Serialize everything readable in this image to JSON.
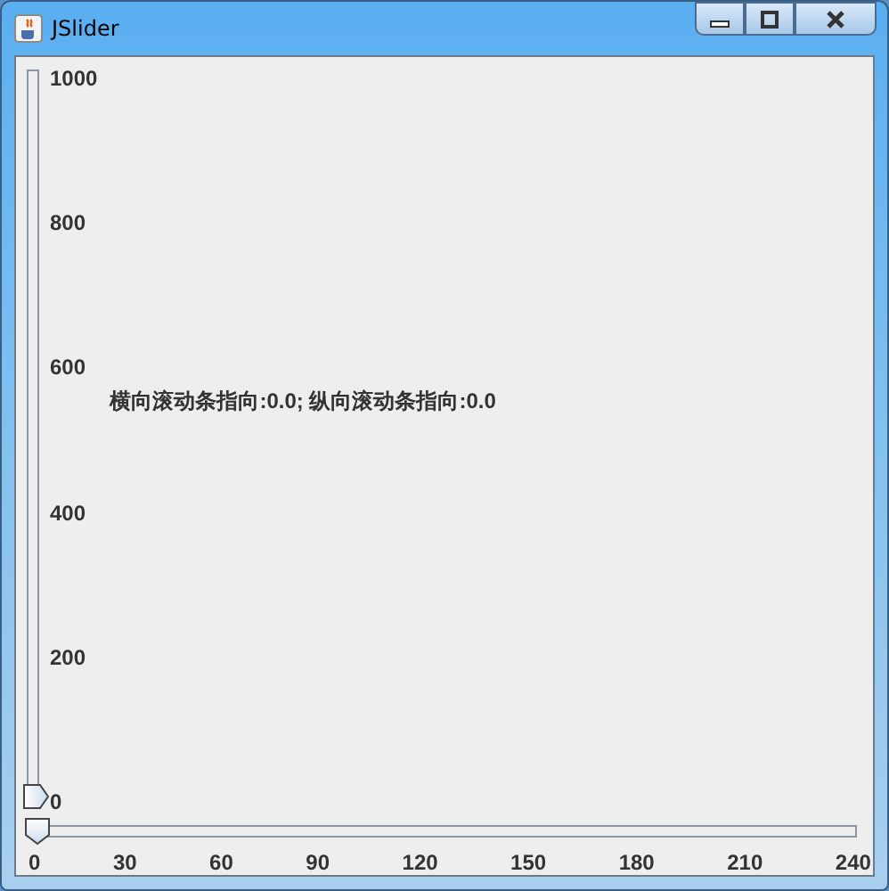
{
  "window": {
    "title": "JSlider"
  },
  "vertical_slider": {
    "level": 0,
    "labels": [
      "1000",
      "800",
      "600",
      "400",
      "200",
      "0"
    ]
  },
  "status_label": "横向滚动条指向:0.0; 纵向滚动条指向:0.0",
  "horizontal_slider": {
    "level": 0,
    "labels": [
      "0",
      "30",
      "60",
      "90",
      "120",
      "150",
      "180",
      "210",
      "240"
    ]
  }
}
